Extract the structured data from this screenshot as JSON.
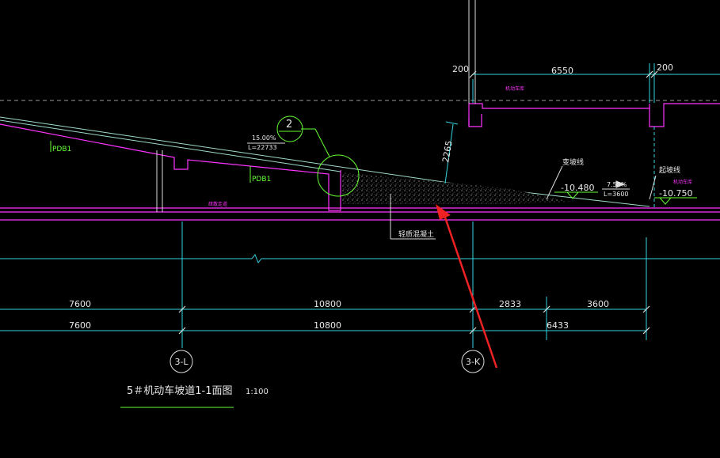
{
  "colors": {
    "background": "#000000",
    "structure": "#ff33ff",
    "axis": "#33d6e0",
    "text": "#e8e8e8",
    "green": "#66ff33",
    "annotation": "#ee2222"
  },
  "dims_top": {
    "left": "200",
    "mid": "6550",
    "right": "200"
  },
  "slope_upper": {
    "pct": "15.00%",
    "len": "L=22733"
  },
  "slope_lower": {
    "pct": "7.50%",
    "len": "L=3600"
  },
  "detail_no": "2",
  "labels": {
    "pdb1_a": "PDB1",
    "pdb1_b": "PDB1",
    "bg_line": "变坡线",
    "begin_line": "起坡线",
    "concrete": "轻质混凝土",
    "dim_2265": "2265",
    "room_top": "机动车库",
    "room_left": "疏散走道",
    "room_right": "机动车库"
  },
  "elevations": {
    "e1": "-10.480",
    "e2": "-10.750"
  },
  "dims_row1": [
    "7600",
    "10800",
    "2833",
    "3600"
  ],
  "dims_row2": [
    "7600",
    "10800",
    "6433"
  ],
  "axes": {
    "left": "3-L",
    "right": "3-K"
  },
  "title": {
    "text": "5＃机动车坡道1-1面图",
    "scale": "1:100"
  }
}
